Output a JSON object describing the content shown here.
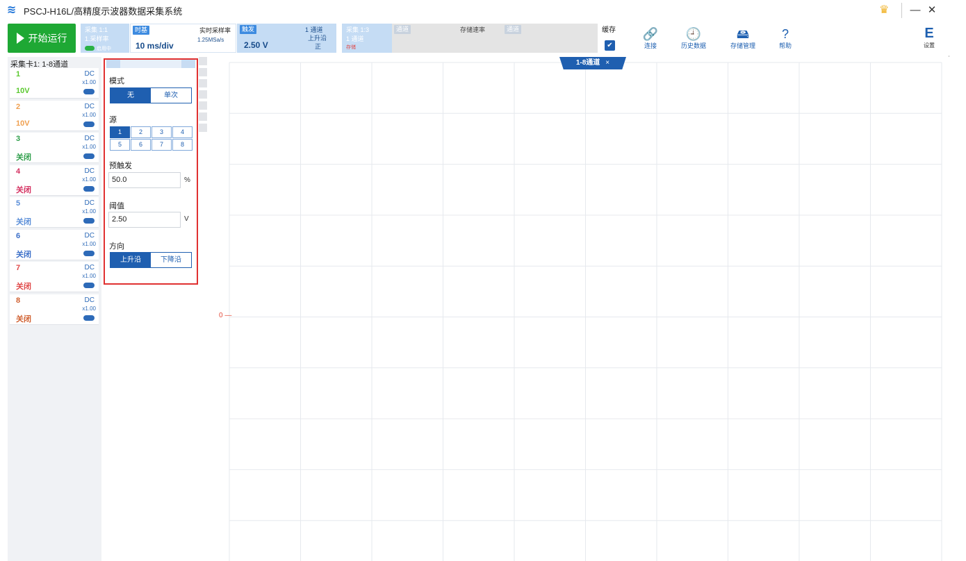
{
  "app": {
    "title": "PSCJ-H16L/高精度示波器数据采集系统"
  },
  "window": {
    "minimize": "—",
    "close": "✕"
  },
  "toolbar": {
    "run_label": "开始运行",
    "card1": {
      "title": "采集 1:1",
      "sub": "1.采样率",
      "toggle_label": "启用中"
    },
    "card2": {
      "label": "时基",
      "value": "10 ms/div",
      "rate_title": "实时采样率",
      "rate_value": "1.25MSa/s"
    },
    "card3": {
      "label": "触发",
      "value": "2.50 V",
      "ch": "1 通道",
      "edge": "上升沿",
      "mode": "正"
    },
    "card4": {
      "title": "采集 1:3",
      "sub": "1 通道",
      "extra": "存储"
    },
    "card5": {
      "lab1": "通道",
      "mid": "存储速率",
      "lab2": "通道"
    },
    "cache_label": "缓存",
    "tools": [
      {
        "icon": "link-icon",
        "glyph": "🔗",
        "label": "连接"
      },
      {
        "icon": "history-icon",
        "glyph": "🕘",
        "label": "历史数据"
      },
      {
        "icon": "storage-icon",
        "glyph": "🖴",
        "label": "存储管理"
      },
      {
        "icon": "help-icon",
        "glyph": "?",
        "label": "帮助"
      }
    ],
    "corner": {
      "glyph": "E",
      "label": "设置"
    }
  },
  "channels": {
    "header": "采集卡1: 1-8通道",
    "items": [
      {
        "num": "1",
        "status": "10V",
        "color": "#5ac82e",
        "mult": "x1.00"
      },
      {
        "num": "2",
        "status": "10V",
        "color": "#f0a050",
        "mult": "x1.00"
      },
      {
        "num": "3",
        "status": "关闭",
        "color": "#2e9e4a",
        "mult": "x1.00"
      },
      {
        "num": "4",
        "status": "关闭",
        "color": "#d43060",
        "mult": "x1.00"
      },
      {
        "num": "5",
        "status": "关闭",
        "color": "#5a8ed8",
        "mult": "x1.00"
      },
      {
        "num": "6",
        "status": "关闭",
        "color": "#3a6ec8",
        "mult": "x1.00"
      },
      {
        "num": "7",
        "status": "关闭",
        "color": "#e04848",
        "mult": "x1.00"
      },
      {
        "num": "8",
        "status": "关闭",
        "color": "#d06030",
        "mult": "x1.00"
      }
    ]
  },
  "trigger": {
    "mode_title": "模式",
    "mode_options": [
      "无",
      "单次"
    ],
    "source_title": "源",
    "sources": [
      "1",
      "2",
      "3",
      "4",
      "5",
      "6",
      "7",
      "8"
    ],
    "pretrig_title": "预触发",
    "pretrig_value": "50.0",
    "pretrig_unit": "%",
    "level_title": "阈值",
    "level_value": "2.50",
    "level_unit": "V",
    "dir_title": "方向",
    "dir_options": [
      "上升沿",
      "下降沿"
    ]
  },
  "plot": {
    "tab_label": "1-8通道",
    "tab_close": "×",
    "zero_label": "0"
  }
}
